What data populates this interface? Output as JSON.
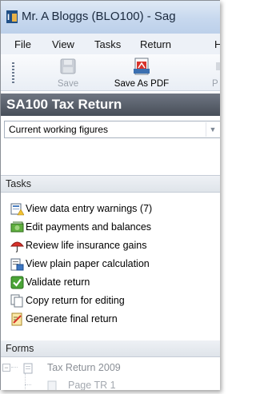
{
  "window": {
    "title": "Mr. A Bloggs (BLO100) - Sag"
  },
  "menu": [
    "File",
    "View",
    "Tasks",
    "Return",
    "H"
  ],
  "toolbar": {
    "save_label": "Save",
    "save_pdf_label": "Save As PDF",
    "cut_label": "P"
  },
  "section_title": "SA100 Tax Return",
  "figures_dropdown": {
    "value": "Current working figures"
  },
  "tasks": {
    "header": "Tasks",
    "items": [
      {
        "label": "View data entry warnings (7)",
        "icon": "warnings-icon"
      },
      {
        "label": "Edit payments and balances",
        "icon": "money-icon"
      },
      {
        "label": "Review life insurance gains",
        "icon": "umbrella-icon"
      },
      {
        "label": "View plain paper calculation",
        "icon": "calculation-icon"
      },
      {
        "label": "Validate return",
        "icon": "checkmark-icon"
      },
      {
        "label": "Copy return for editing",
        "icon": "copy-icon"
      },
      {
        "label": "Generate final return",
        "icon": "generate-icon"
      }
    ]
  },
  "forms": {
    "header": "Forms",
    "tree": [
      {
        "label": "Tax Return 2009",
        "level": 0
      },
      {
        "label": "Page TR 1",
        "level": 1
      }
    ]
  }
}
